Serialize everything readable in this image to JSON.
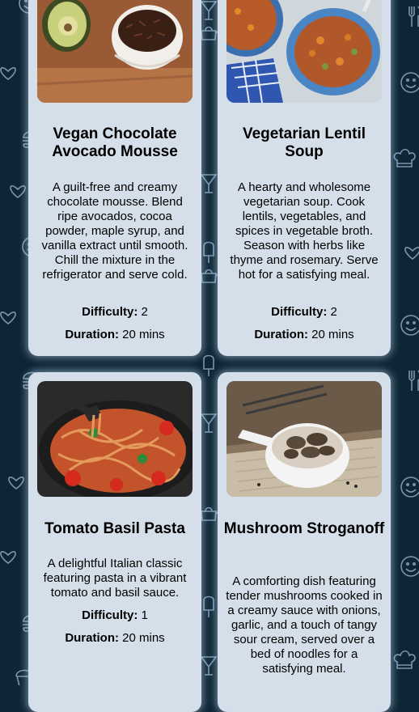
{
  "recipes": [
    {
      "title": "Vegan Chocolate Avocado Mousse",
      "description": "A guilt-free and creamy chocolate mousse. Blend ripe avocados, cocoa powder, maple syrup, and vanilla extract until smooth. Chill the mixture in the refrigerator and serve cold.",
      "difficulty_label": "Difficulty:",
      "difficulty": "2",
      "duration_label": "Duration:",
      "duration": "20 mins"
    },
    {
      "title": "Vegetarian Lentil Soup",
      "description": "A hearty and wholesome vegetarian soup. Cook lentils, vegetables, and spices in vegetable broth. Season with herbs like thyme and rosemary. Serve hot for a satisfying meal.",
      "difficulty_label": "Difficulty:",
      "difficulty": "2",
      "duration_label": "Duration:",
      "duration": "20 mins"
    },
    {
      "title": "Tomato Basil Pasta",
      "description": "A delightful Italian classic featuring pasta in a vibrant tomato and basil sauce.",
      "difficulty_label": "Difficulty:",
      "difficulty": "1",
      "duration_label": "Duration:",
      "duration": "20 mins"
    },
    {
      "title": "Mushroom Stroganoff",
      "description": "A comforting dish featuring tender mushrooms cooked in a creamy sauce with onions, garlic, and a touch of tangy sour cream, served over a bed of noodles for a satisfying meal."
    }
  ],
  "colors": {
    "page_background": "#0e2535",
    "card_background": "#d5dfe9",
    "card_glow": "#bedcf5",
    "pattern_stroke": "#8fa9bd"
  },
  "background_icons": [
    "heart-icon",
    "smiley-icon",
    "chef-hat-icon",
    "cupcake-icon",
    "wine-glass-icon",
    "popsicle-icon",
    "cutlery-icon",
    "teapot-icon",
    "burger-icon"
  ]
}
